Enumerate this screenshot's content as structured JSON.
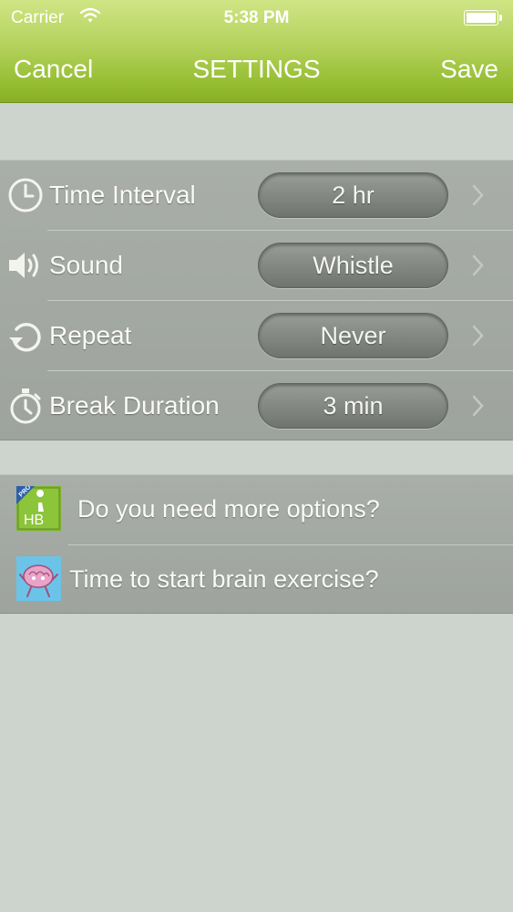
{
  "status_bar": {
    "carrier": "Carrier",
    "time": "5:38 PM"
  },
  "nav": {
    "cancel": "Cancel",
    "title": "SETTINGS",
    "save": "Save"
  },
  "settings": [
    {
      "label": "Time Interval",
      "value": "2 hr",
      "icon": "clock-icon"
    },
    {
      "label": "Sound",
      "value": "Whistle",
      "icon": "speaker-icon"
    },
    {
      "label": "Repeat",
      "value": "Never",
      "icon": "repeat-icon"
    },
    {
      "label": "Break Duration",
      "value": "3 min",
      "icon": "stopwatch-icon"
    }
  ],
  "links": [
    {
      "label": "Do you need more options?",
      "icon": "hb-pro-app-icon",
      "icon_badge": "PRO",
      "icon_text": "HB"
    },
    {
      "label": "Time to start brain exercise?",
      "icon": "brain-app-icon"
    }
  ],
  "colors": {
    "nav_green": "#93bb2e",
    "background": "#cdd3cd",
    "group_gray": "#a4a9a4"
  }
}
